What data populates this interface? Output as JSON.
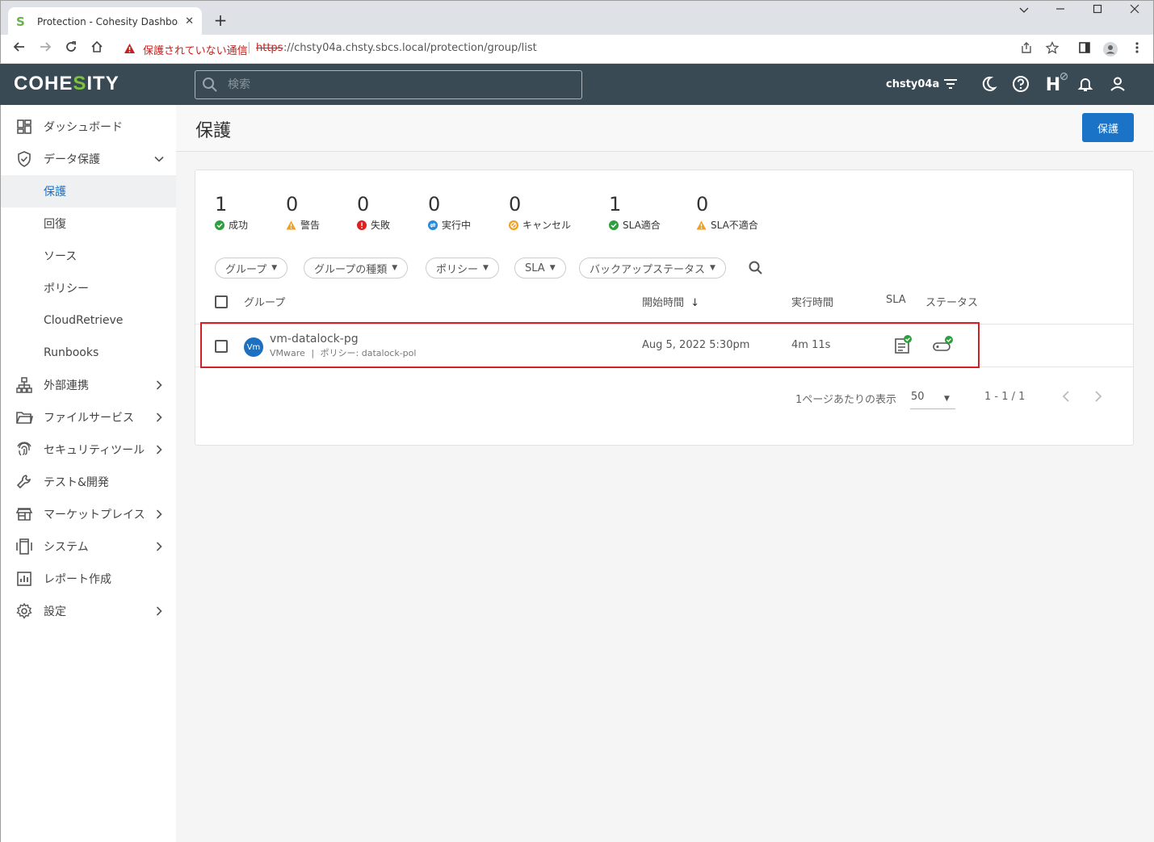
{
  "browser": {
    "tab_title": "Protection - Cohesity Dashboard",
    "tab_close": "✕",
    "new_tab": "+",
    "security_warning": "保護されていない通信",
    "url_scheme": "https",
    "url_rest": "://chsty04a.chsty.sbcs.local/protection/group/list"
  },
  "header": {
    "logo_left": "COHE",
    "logo_s": "S",
    "logo_right": "ITY",
    "search_placeholder": "検索",
    "user": "chsty04a",
    "helios_label": "H"
  },
  "sidebar": {
    "items": [
      {
        "label": "ダッシュボード",
        "icon": "dashboard-icon"
      },
      {
        "label": "データ保護",
        "icon": "shield-icon",
        "expanded": true
      },
      {
        "label": "保護",
        "active": true
      },
      {
        "label": "回復"
      },
      {
        "label": "ソース"
      },
      {
        "label": "ポリシー"
      },
      {
        "label": "CloudRetrieve"
      },
      {
        "label": "Runbooks"
      },
      {
        "label": "外部連携",
        "icon": "network-icon"
      },
      {
        "label": "ファイルサービス",
        "icon": "folder-icon"
      },
      {
        "label": "セキュリティツール",
        "icon": "fingerprint-icon"
      },
      {
        "label": "テスト&開発",
        "icon": "wrench-icon"
      },
      {
        "label": "マーケットプレイス",
        "icon": "store-icon"
      },
      {
        "label": "システム",
        "icon": "system-icon"
      },
      {
        "label": "レポート作成",
        "icon": "report-icon"
      },
      {
        "label": "設定",
        "icon": "gear-icon"
      }
    ]
  },
  "page": {
    "title": "保護",
    "protect_button": "保護"
  },
  "stats": [
    {
      "value": "1",
      "label": "成功",
      "status": "success",
      "color": "#2e9e3e"
    },
    {
      "value": "0",
      "label": "警告",
      "status": "warning",
      "color": "#f0a020"
    },
    {
      "value": "0",
      "label": "失敗",
      "status": "failed",
      "color": "#e02020"
    },
    {
      "value": "0",
      "label": "実行中",
      "status": "running",
      "color": "#2a8ad8"
    },
    {
      "value": "0",
      "label": "キャンセル",
      "status": "canceled",
      "color": "#f0a020"
    },
    {
      "value": "1",
      "label": "SLA適合",
      "status": "sla-met",
      "color": "#2e9e3e"
    },
    {
      "value": "0",
      "label": "SLA不適合",
      "status": "sla-missed",
      "color": "#f0a020"
    }
  ],
  "filters": [
    "グループ",
    "グループの種類",
    "ポリシー",
    "SLA",
    "バックアップステータス"
  ],
  "table": {
    "columns": {
      "group": "グループ",
      "start_time": "開始時間",
      "run_time": "実行時間",
      "sla": "SLA",
      "status": "ステータス"
    },
    "sort_indicator": "↓",
    "rows": [
      {
        "avatar": "Vm",
        "name": "vm-datalock-pg",
        "environment": "VMware",
        "separator": "|",
        "policy": "ポリシー: datalock-pol",
        "start_time": "Aug 5, 2022 5:30pm",
        "run_time": "4m 11s"
      }
    ]
  },
  "pagination": {
    "per_page_label": "1ページあたりの表示",
    "per_page_value": "50",
    "range": "1 - 1 / 1"
  }
}
